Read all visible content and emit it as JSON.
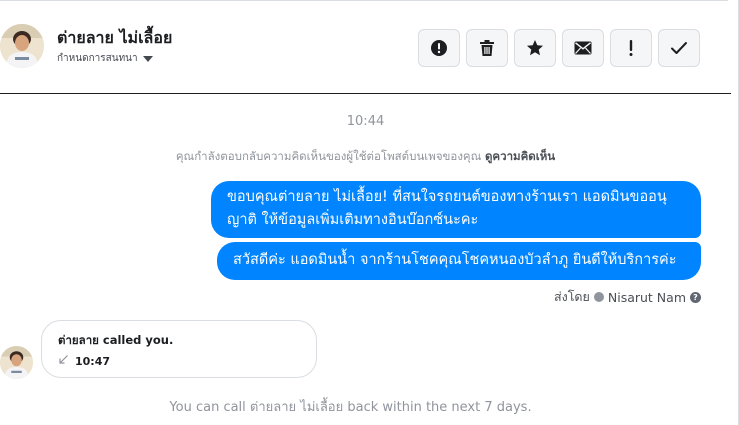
{
  "header": {
    "contact_name": "ต่ายลาย ไม่เลื้อย",
    "subtitle": "กำหนดการสนทนา"
  },
  "toolbar": {
    "buttons": [
      {
        "icon": "alert-circle-icon"
      },
      {
        "icon": "trash-icon"
      },
      {
        "icon": "star-icon"
      },
      {
        "icon": "envelope-icon"
      },
      {
        "icon": "exclamation-icon"
      },
      {
        "icon": "checkmark-icon"
      }
    ]
  },
  "conversation": {
    "timestamp": "10:44",
    "notice_text": "คุณกำลังตอบกลับความคิดเห็นของผู้ใช้ต่อโพสต์บนเพจของคุณ",
    "notice_link": "ดูความคิดเห็น",
    "messages": [
      {
        "from": "page",
        "text": "ขอบคุณต่ายลาย ไม่เลื้อย! ที่สนใจรถยนต์ของทางร้านเรา แอดมินขออนุญาติ ให้ข้อมูลเพิ่มเติมทางอินบ๊อกซ์นะคะ"
      },
      {
        "from": "page",
        "text": "สวัสดีค่ะ แอดมินน้ำ จากร้านโชคคุณโชคหนองบัวลำภู ยินดีให้บริการค่ะ"
      }
    ],
    "sent_by_label": "ส่งโดย",
    "sent_by_name": "Nisarut Nam",
    "help_glyph": "?",
    "call": {
      "title": "ต่ายลาย called you.",
      "time": "10:47"
    },
    "callback_text": "You can call ต่ายลาย ไม่เลื้อย back within the next 7 days."
  },
  "colors": {
    "accent": "#0084ff",
    "muted_text": "#90949c"
  }
}
